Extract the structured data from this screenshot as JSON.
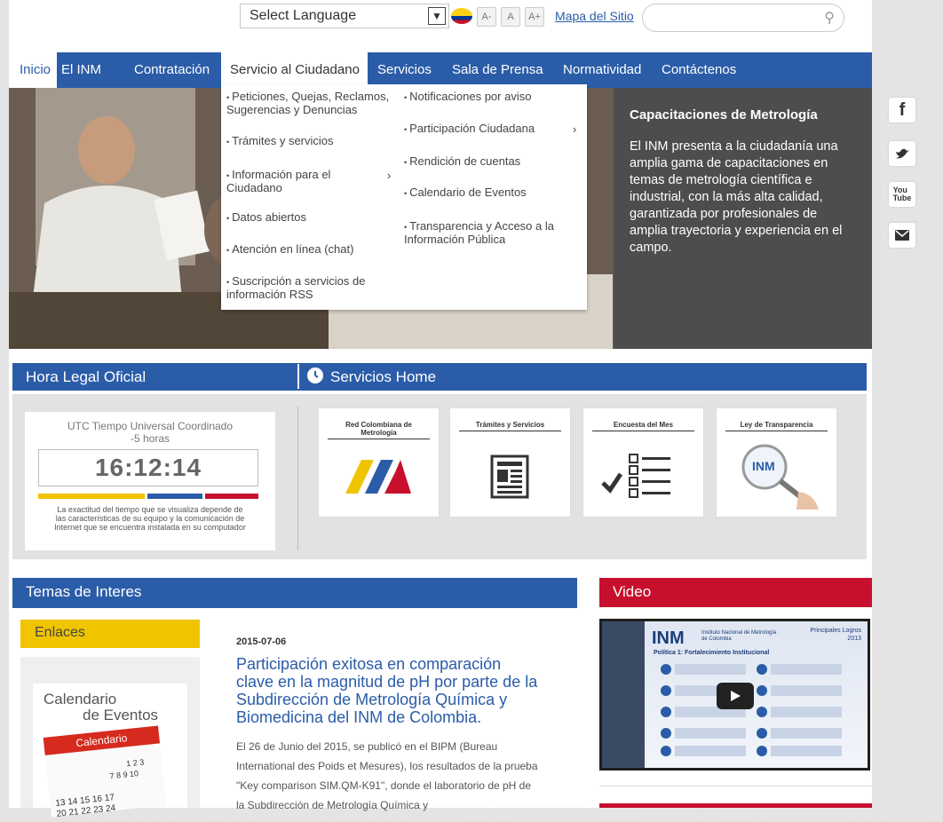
{
  "header": {
    "language_select": "Select Language",
    "font_small": "A-",
    "font_normal": "A",
    "font_large": "A+",
    "sitemap_link": "Mapa del Sitio"
  },
  "nav": {
    "items": [
      "Inicio",
      "El INM",
      "Contratación",
      "Servicio al Ciudadano",
      "Servicios",
      "Sala de Prensa",
      "Normatividad",
      "Contáctenos"
    ]
  },
  "dropdown": {
    "col1": [
      "Peticiones, Quejas, Reclamos, Sugerencias y Denuncias",
      "Trámites y servicios",
      "Información para el Ciudadano",
      "Datos abiertos",
      "Atención en línea (chat)",
      "Suscripción a servicios de información RSS"
    ],
    "col2": [
      "Notificaciones por aviso",
      "Participación Ciudadana",
      "Rendición de cuentas",
      "Calendario de Eventos",
      "Transparencia y Acceso a la Información Pública"
    ]
  },
  "hero": {
    "title": "Capacitaciones de Metrología",
    "text": "El INM presenta a la ciudadanía una amplia gama de capacitaciones en temas de metrología científica e industrial, con la más alta calidad, garantizada por profesionales de amplia trayectoria y experiencia en el campo."
  },
  "hora": {
    "header": "Hora Legal Oficial",
    "utc_label": "UTC Tiempo Universal Coordinado\n-5 horas",
    "time": "16:12:14",
    "note": "La exactitud del tiempo que se visualiza depende de las características de su equipo y la comunicación de Internet que se encuentra instalada en su computador"
  },
  "servicios": {
    "header": "Servicios Home",
    "cards": [
      "Red Colombiana de Metrología",
      "Trámites y Servicios",
      "Encuesta del Mes",
      "Ley de Transparencia"
    ]
  },
  "temas": {
    "header": "Temas de Interes",
    "enlaces": "Enlaces",
    "calendario_title1": "Calendario",
    "calendario_title2": "de Eventos",
    "calendario_label": "Calendario",
    "date": "2015-07-06",
    "headline": "Participación exitosa en comparación clave en la magnitud de pH por parte de la Subdirección de Metrología Química y Biomedicina del INM de Colombia.",
    "body": "El 26 de Junio del 2015, se publicó en el BIPM (Bureau International des Poids et Mesures), los resultados de la prueba \"Key comparison SIM.QM-K91\", donde el laboratorio de pH de la Subdirección de Metrología Química y"
  },
  "video": {
    "header": "Video",
    "logo": "INM",
    "inst_name": "Instituto Nacional de Metrología de Colombia",
    "logros": "Principales Logros 2013",
    "politica": "Política 1: Fortalecimiento Institucional"
  },
  "colors": {
    "brand_blue": "#2b5ca8",
    "video_red": "#c8102e",
    "enlaces_yellow": "#f1c400"
  }
}
